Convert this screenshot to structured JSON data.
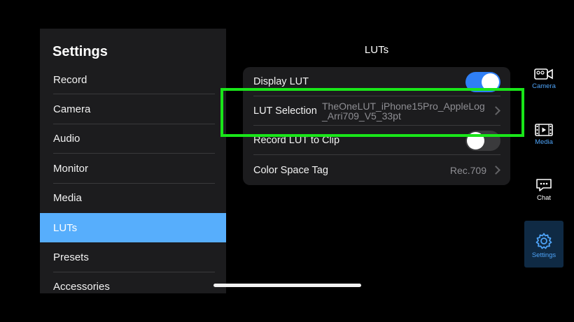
{
  "sidebar": {
    "title": "Settings",
    "items": [
      {
        "label": "Record"
      },
      {
        "label": "Camera"
      },
      {
        "label": "Audio"
      },
      {
        "label": "Monitor"
      },
      {
        "label": "Media"
      },
      {
        "label": "LUTs"
      },
      {
        "label": "Presets"
      },
      {
        "label": "Accessories"
      }
    ],
    "active_item": "LUTs"
  },
  "main": {
    "title": "LUTs",
    "display_lut": {
      "label": "Display LUT",
      "toggle": "on"
    },
    "lut_selection": {
      "label": "LUT Selection",
      "value": "TheOneLUT_iPhone15Pro_AppleLog_Arri709_V5_33pt"
    },
    "record_lut": {
      "label": "Record LUT to Clip",
      "toggle": "off"
    },
    "color_space": {
      "label": "Color Space Tag",
      "value": "Rec.709"
    }
  },
  "right_nav": {
    "camera": {
      "label": "Camera",
      "icon": "camera-icon"
    },
    "media": {
      "label": "Media",
      "icon": "film-icon"
    },
    "chat": {
      "label": "Chat",
      "icon": "chat-icon"
    },
    "settings": {
      "label": "Settings",
      "icon": "gear-icon"
    }
  },
  "colors": {
    "accent": "#57aefc",
    "toggle_on": "#2f7ff6",
    "highlight": "#19e619"
  }
}
